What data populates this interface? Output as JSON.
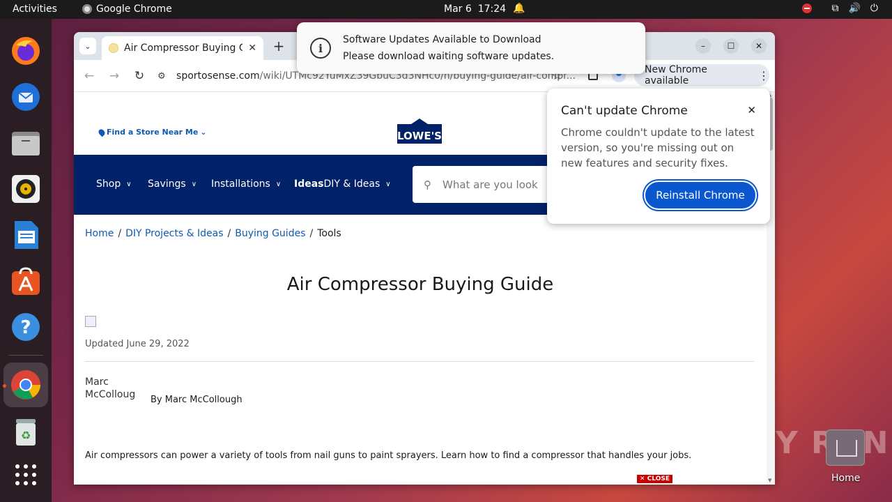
{
  "topbar": {
    "activities": "Activities",
    "app_name": "Google Chrome",
    "date": "Mar 6",
    "time": "17:24"
  },
  "dock": {
    "items": [
      "firefox-icon",
      "thunderbird-icon",
      "files-icon",
      "rhythmbox-icon",
      "libreoffice-writer-icon",
      "app-center-icon",
      "help-icon",
      "chrome-icon",
      "trash-icon",
      "show-apps-icon"
    ]
  },
  "browser": {
    "tab_title": "Air Compressor Buying Guide",
    "url_host": "sportosense.com",
    "url_path": "/wiki/UTMc92YuMxZ39GbuC3d3NHc0/n/buying-guide/air-compr...",
    "new_chrome": "New Chrome available"
  },
  "notification": {
    "title": "Software Updates Available to Download",
    "body": "Please download waiting software updates."
  },
  "popup": {
    "title": "Can't update Chrome",
    "body": "Chrome couldn't update to the latest version, so you're missing out on new features and security fixes.",
    "button": "Reinstall Chrome"
  },
  "site": {
    "store_link": "Find a Store Near Me",
    "logo_text": "LOWE'S",
    "nav": {
      "shop": "Shop",
      "savings": "Savings",
      "installations": "Installations",
      "ideas_bold": "Ideas",
      "ideas": "DIY & Ideas"
    },
    "search_placeholder": "What are you look",
    "breadcrumb": {
      "home": "Home",
      "diy": "DIY Projects & Ideas",
      "guides": "Buying Guides",
      "current": "Tools"
    },
    "title": "Air Compressor Buying Guide",
    "updated": "Updated June 29, 2022",
    "author_alt": "Marc McColloug",
    "author_by": "By Marc McCollough",
    "intro": "Air compressors can power a variety of tools from nail guns to paint sprayers. Learn how to find a compressor that handles your jobs.",
    "ad_close": "CLOSE"
  },
  "desktop": {
    "home_label": "Home",
    "watermark": "ANY RUN"
  },
  "colors": {
    "lowes_blue": "#012169",
    "link_blue": "#0d5bb5",
    "chrome_button": "#0b57d0",
    "ubuntu_orange": "#e95420"
  }
}
